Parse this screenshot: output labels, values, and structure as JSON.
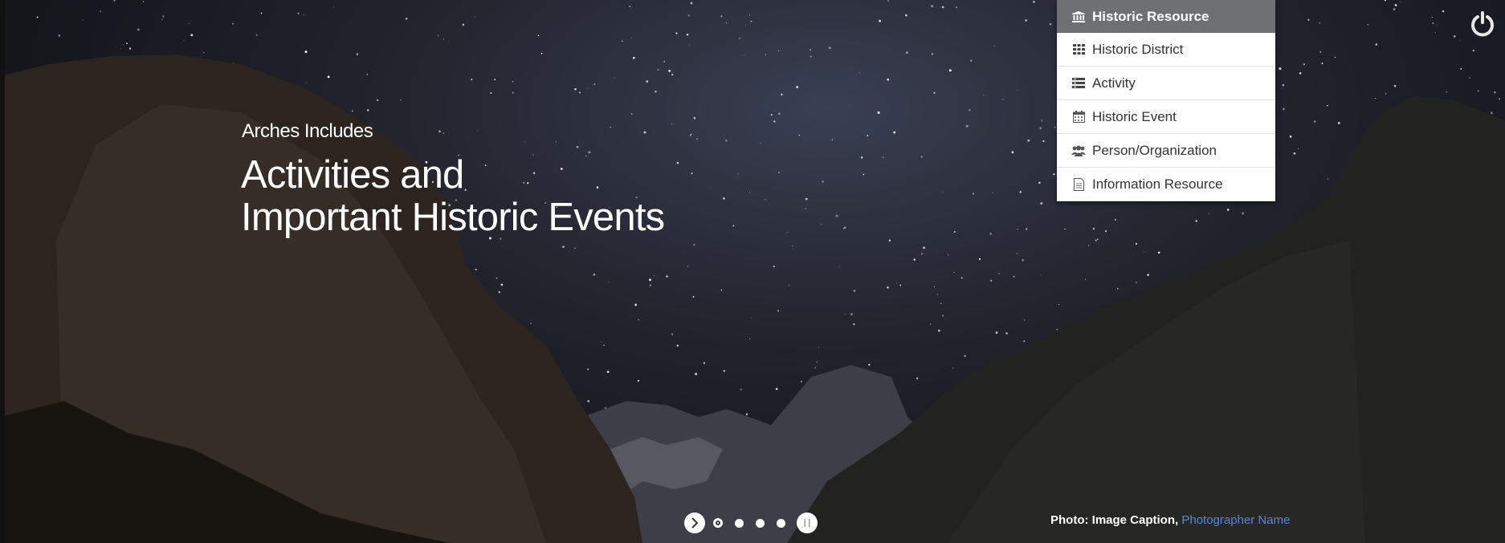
{
  "hero": {
    "kicker": "Arches Includes",
    "headline_line1": "Activities and",
    "headline_line2": "Important Historic Events"
  },
  "resource_menu": {
    "items": [
      {
        "label": "Historic Resource",
        "icon": "building-columns-icon",
        "active": true
      },
      {
        "label": "Historic District",
        "icon": "grid-icon",
        "active": false
      },
      {
        "label": "Activity",
        "icon": "list-icon",
        "active": false
      },
      {
        "label": "Historic Event",
        "icon": "calendar-icon",
        "active": false
      },
      {
        "label": "Person/Organization",
        "icon": "users-icon",
        "active": false
      },
      {
        "label": "Information Resource",
        "icon": "document-icon",
        "active": false
      }
    ]
  },
  "carousel": {
    "slide_count": 4,
    "current_slide": 1
  },
  "caption": {
    "prefix": "Photo: Image Caption,",
    "photographer": "Photographer Name"
  },
  "colors": {
    "menu_active_bg": "#6f7072",
    "caption_link": "#5a86d6"
  }
}
